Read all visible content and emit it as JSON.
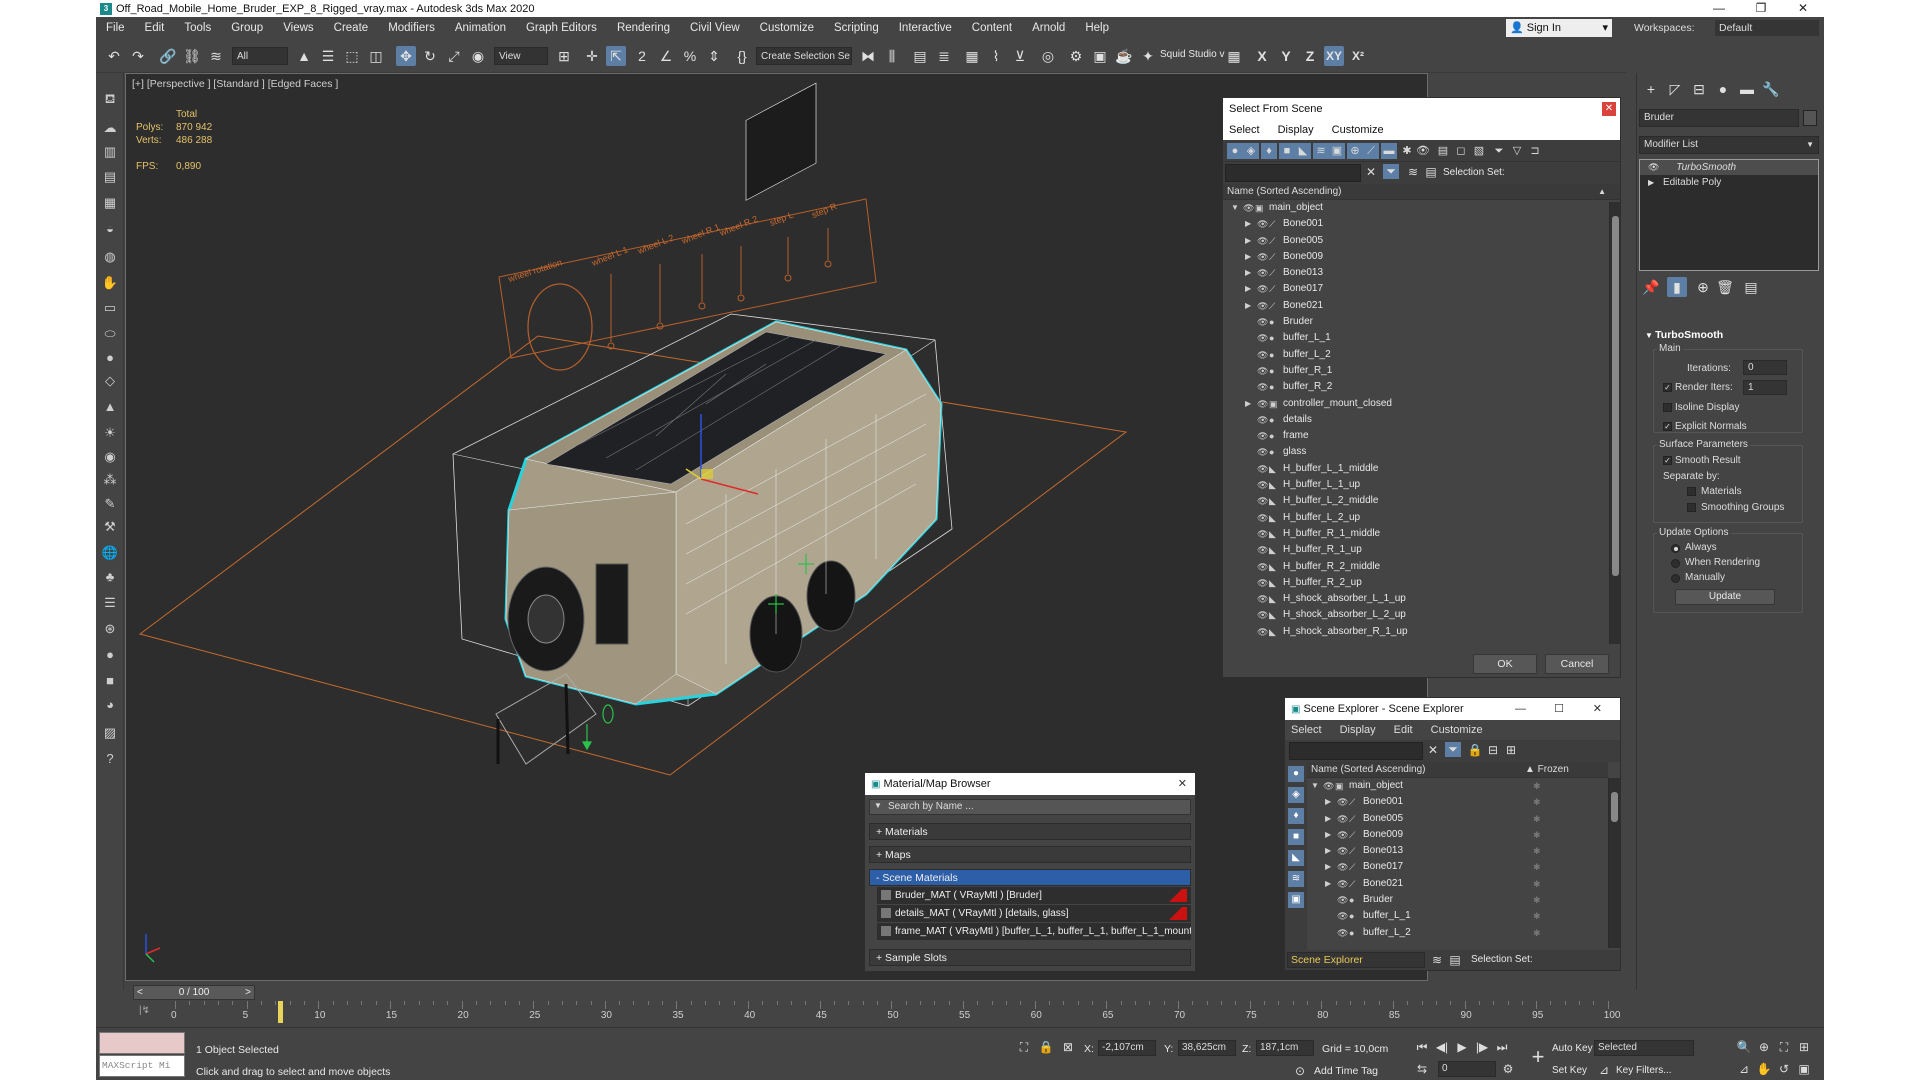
{
  "window": {
    "title": "Off_Road_Mobile_Home_Bruder_EXP_8_Rigged_vray.max - Autodesk 3ds Max 2020",
    "min": "—",
    "max": "❐",
    "close": "✕"
  },
  "menu": [
    "File",
    "Edit",
    "Tools",
    "Group",
    "Views",
    "Create",
    "Modifiers",
    "Animation",
    "Graph Editors",
    "Rendering",
    "Civil View",
    "Customize",
    "Scripting",
    "Interactive",
    "Content",
    "Arnold",
    "Help"
  ],
  "signin": {
    "label": "Sign In",
    "arrow": "▾"
  },
  "workspaces": {
    "label": "Workspaces:",
    "value": "Default"
  },
  "toolbar": {
    "filter": "All",
    "refcoord": "View",
    "selset": "Create Selection Se",
    "squid": "Squid Studio v",
    "axes": [
      "X",
      "Y",
      "Z",
      "XY",
      "X²"
    ]
  },
  "viewport": {
    "label": "[+] [Perspective ] [Standard ] [Edged Faces ]",
    "stats": {
      "header": "Total",
      "polys_label": "Polys:",
      "polys": "870 942",
      "verts_label": "Verts:",
      "verts": "486 288",
      "fps_label": "FPS:",
      "fps": "0,890"
    },
    "overlay": [
      "wheel rotation",
      "wheel L 1",
      "wheel L 2",
      "wheel R 1",
      "wheel R 2",
      "step L",
      "step R"
    ]
  },
  "select_scene": {
    "title": "Select From Scene",
    "close": "✕",
    "menu": [
      "Select",
      "Display",
      "Customize"
    ],
    "selection_set": "Selection Set:",
    "column": "Name (Sorted Ascending)",
    "sort_arrow": "▲",
    "rows": [
      {
        "name": "main_object",
        "level": 0,
        "exp": "open",
        "icon": "group"
      },
      {
        "name": "Bone001",
        "level": 1,
        "exp": "closed",
        "icon": "bone"
      },
      {
        "name": "Bone005",
        "level": 1,
        "exp": "closed",
        "icon": "bone"
      },
      {
        "name": "Bone009",
        "level": 1,
        "exp": "closed",
        "icon": "bone"
      },
      {
        "name": "Bone013",
        "level": 1,
        "exp": "closed",
        "icon": "bone"
      },
      {
        "name": "Bone017",
        "level": 1,
        "exp": "closed",
        "icon": "bone"
      },
      {
        "name": "Bone021",
        "level": 1,
        "exp": "closed",
        "icon": "bone"
      },
      {
        "name": "Bruder",
        "level": 1,
        "exp": "",
        "icon": "mesh"
      },
      {
        "name": "buffer_L_1",
        "level": 1,
        "exp": "",
        "icon": "mesh"
      },
      {
        "name": "buffer_L_2",
        "level": 1,
        "exp": "",
        "icon": "mesh"
      },
      {
        "name": "buffer_R_1",
        "level": 1,
        "exp": "",
        "icon": "mesh"
      },
      {
        "name": "buffer_R_2",
        "level": 1,
        "exp": "",
        "icon": "mesh"
      },
      {
        "name": "controller_mount_closed",
        "level": 1,
        "exp": "closed",
        "icon": "group"
      },
      {
        "name": "details",
        "level": 1,
        "exp": "",
        "icon": "mesh"
      },
      {
        "name": "frame",
        "level": 1,
        "exp": "",
        "icon": "mesh"
      },
      {
        "name": "glass",
        "level": 1,
        "exp": "",
        "icon": "mesh"
      },
      {
        "name": "H_buffer_L_1_middle",
        "level": 1,
        "exp": "",
        "icon": "helper"
      },
      {
        "name": "H_buffer_L_1_up",
        "level": 1,
        "exp": "",
        "icon": "helper"
      },
      {
        "name": "H_buffer_L_2_middle",
        "level": 1,
        "exp": "",
        "icon": "helper"
      },
      {
        "name": "H_buffer_L_2_up",
        "level": 1,
        "exp": "",
        "icon": "helper"
      },
      {
        "name": "H_buffer_R_1_middle",
        "level": 1,
        "exp": "",
        "icon": "helper"
      },
      {
        "name": "H_buffer_R_1_up",
        "level": 1,
        "exp": "",
        "icon": "helper"
      },
      {
        "name": "H_buffer_R_2_middle",
        "level": 1,
        "exp": "",
        "icon": "helper"
      },
      {
        "name": "H_buffer_R_2_up",
        "level": 1,
        "exp": "",
        "icon": "helper"
      },
      {
        "name": "H_shock_absorber_L_1_up",
        "level": 1,
        "exp": "",
        "icon": "helper"
      },
      {
        "name": "H_shock_absorber_L_2_up",
        "level": 1,
        "exp": "",
        "icon": "helper"
      },
      {
        "name": "H_shock_absorber_R_1_up",
        "level": 1,
        "exp": "",
        "icon": "helper"
      }
    ],
    "ok": "OK",
    "cancel": "Cancel"
  },
  "scene_explorer": {
    "title": "Scene Explorer - Scene Explorer",
    "min": "—",
    "max": "☐",
    "close": "✕",
    "menu": [
      "Select",
      "Display",
      "Edit",
      "Customize"
    ],
    "column": "Name (Sorted Ascending)",
    "frozen": "▲ Frozen",
    "rows": [
      {
        "name": "main_object",
        "level": 0,
        "exp": "open",
        "icon": "group"
      },
      {
        "name": "Bone001",
        "level": 1,
        "exp": "closed",
        "icon": "bone"
      },
      {
        "name": "Bone005",
        "level": 1,
        "exp": "closed",
        "icon": "bone"
      },
      {
        "name": "Bone009",
        "level": 1,
        "exp": "closed",
        "icon": "bone"
      },
      {
        "name": "Bone013",
        "level": 1,
        "exp": "closed",
        "icon": "bone"
      },
      {
        "name": "Bone017",
        "level": 1,
        "exp": "closed",
        "icon": "bone"
      },
      {
        "name": "Bone021",
        "level": 1,
        "exp": "closed",
        "icon": "bone"
      },
      {
        "name": "Bruder",
        "level": 1,
        "exp": "",
        "icon": "mesh"
      },
      {
        "name": "buffer_L_1",
        "level": 1,
        "exp": "",
        "icon": "mesh"
      },
      {
        "name": "buffer_L_2",
        "level": 1,
        "exp": "",
        "icon": "mesh"
      }
    ],
    "footer": "Scene Explorer",
    "selection_set": "Selection Set:"
  },
  "material_browser": {
    "title": "Material/Map Browser",
    "close": "✕",
    "search": "Search by Name ...",
    "sections": [
      "+ Materials",
      "+ Maps",
      "- Scene Materials",
      "+ Sample Slots"
    ],
    "materials": [
      "Bruder_MAT  ( VRayMtl )  [Bruder]",
      "details_MAT  ( VRayMtl )  [details, glass]",
      "frame_MAT  ( VRayMtl )  [buffer_L_1, buffer_L_1, buffer_L_1_mount, buffer..."
    ]
  },
  "command_panel": {
    "object_name": "Bruder",
    "modifier_list": "Modifier List",
    "stack": [
      "TurboSmooth",
      "Editable Poly"
    ],
    "rollout": "TurboSmooth",
    "main": "Main",
    "iterations_label": "Iterations:",
    "iterations": "0",
    "render_iters_label": "Render Iters:",
    "render_iters": "1",
    "isoline": "Isoline Display",
    "explicit": "Explicit Normals",
    "surface": "Surface Parameters",
    "smooth": "Smooth Result",
    "separate": "Separate by:",
    "materials": "Materials",
    "smoothing": "Smoothing Groups",
    "update_options": "Update Options",
    "always": "Always",
    "when_rendering": "When Rendering",
    "manually": "Manually",
    "update": "Update"
  },
  "timeline": {
    "frame": "0 / 100",
    "prev": "<",
    "next": ">",
    "ticks": [
      "0",
      "5",
      "10",
      "15",
      "20",
      "25",
      "30",
      "35",
      "40",
      "45",
      "50",
      "55",
      "60",
      "65",
      "70",
      "75",
      "80",
      "85",
      "90",
      "95",
      "100"
    ]
  },
  "status": {
    "maxscript": "MAXScript Mi",
    "selected": "1 Object Selected",
    "hint": "Click and drag to select and move objects",
    "x_label": "X:",
    "x": "-2,107cm",
    "y_label": "Y:",
    "y": "38,625cm",
    "z_label": "Z:",
    "z": "187,1cm",
    "grid": "Grid = 10,0cm",
    "add_time_tag": "Add Time Tag",
    "autokey": "Auto Key",
    "setkey": "Set Key",
    "selected_drop": "Selected",
    "key_filters": "Key Filters...",
    "frame_field": "0"
  }
}
